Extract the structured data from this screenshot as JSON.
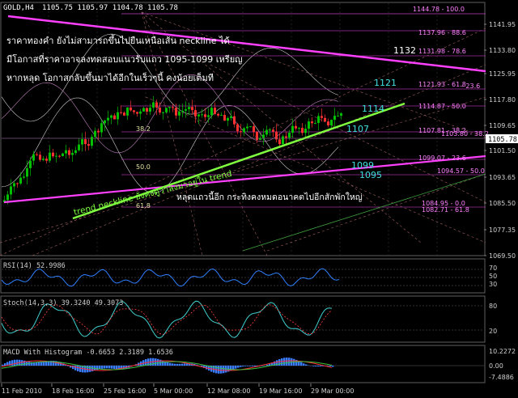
{
  "header": {
    "symbol": "GOLD,H4",
    "ohlc": "1105.75 1105.97 1104.78 1105.78"
  },
  "annotation_lines": [
    "ราคาทองคำ ยังไม่สามารถขึ้นไปยืนเหนือเส้น neckline ได้",
    "มีโอกาสที่ราคาอาจลงทดสอบแนวรับแถว 1095-1099 เหรียญ",
    "หากหลุด โอกาสกลับขึ้นมาได้อีกในเร็วๆนี้ คงน้อยเต็มที"
  ],
  "main_axis": {
    "ticks": [
      "1141.95",
      "1133.80",
      "1125.95",
      "1117.80",
      "1109.65",
      "1101.50",
      "1093.65",
      "1085.50",
      "1077.35",
      "1069.50"
    ],
    "current_price": "1105.78"
  },
  "fib_levels": [
    {
      "label": "1144.78 - 100.0"
    },
    {
      "label": "1137.96 - 88.6"
    },
    {
      "label": "1131.98 - 78.6"
    },
    {
      "label": "1121.93 - 61.8"
    },
    {
      "label": "- 23.6"
    },
    {
      "label": "1114.87 - 50.0"
    },
    {
      "label": "1107.81 - 38.2"
    },
    {
      "label": "1103.80 - 38.2"
    },
    {
      "label": "1099.07 - 23.6"
    },
    {
      "label": "1094.57 - 50.0"
    },
    {
      "label": "1084.95 - 0.0"
    },
    {
      "label": "1082.71 - 61.8"
    }
  ],
  "retracement_labels": {
    "r382": "38.2",
    "r500": "50.0",
    "r618": "61.8"
  },
  "price_markers": {
    "p1132": "1132",
    "p1121": "1121",
    "p1114": "1114",
    "p1107": "1107",
    "p1099": "1099",
    "p1095": "1095"
  },
  "chart_annotations": {
    "neckline": "trend neckline ยังคงดูว่าลงมาอยู่ใน trend",
    "break_note": "หลุดแถวนี้อีก กระทิงคงหมดอนาคตไปอีกสักพักใหญ่"
  },
  "rsi": {
    "label": "RSI(14) 52.9986",
    "ticks": [
      "70",
      "50",
      "30"
    ]
  },
  "stoch": {
    "label": "Stoch(14,3,3) 39.3240 49.3073",
    "ticks": [
      "80",
      "20"
    ]
  },
  "macd": {
    "label": "MACD With Histogram -0.6653 2.3189 1.6536",
    "ticks": [
      "10.2272",
      "0.00",
      "-7.4886"
    ]
  },
  "x_axis": {
    "ticks": [
      "11 Feb 2010",
      "18 Feb 16:00",
      "25 Feb 16:00",
      "5 Mar 00:00",
      "12 Mar 08:00",
      "19 Mar 16:00",
      "29 Mar 00:00"
    ]
  },
  "colors": {
    "background": "#000000",
    "bull": "#00c000",
    "bear": "#ff3030",
    "grid": "#505050",
    "fib": "#ff40ff",
    "neckline": "#80ff40",
    "marker": "#40e0e0",
    "rsi": "#3080ff",
    "macd_hist": "#3a7cff"
  }
}
